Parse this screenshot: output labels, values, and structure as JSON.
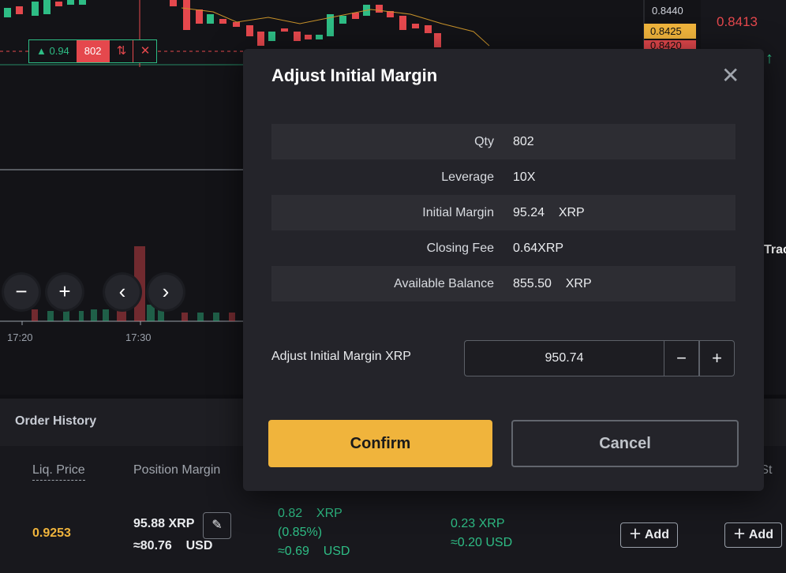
{
  "chart": {
    "price_axis": {
      "top": "0.8440",
      "last": "0.8425",
      "partial": "0.8420"
    },
    "side_price": "0.8413",
    "side_label": "Trac",
    "position_tag": {
      "pnl": "▲ 0.94",
      "qty": "802"
    },
    "controls": {
      "zoom_out": "−",
      "zoom_in": "+",
      "prev": "‹",
      "next": "›"
    },
    "time_labels": [
      "17:20",
      "17:30"
    ],
    "colors": {
      "up": "#2ebd85",
      "down": "#e5484d",
      "accent": "#f0b43c"
    }
  },
  "bottom": {
    "order_history": "Order History",
    "columns": {
      "liq_price": "Liq. Price",
      "position_margin": "Position Margin",
      "truncated": "g St"
    },
    "row": {
      "liq_price": "0.9253",
      "margin_xrp": "95.88 XRP",
      "margin_usd": "≈80.76    USD",
      "pnl_xrp": "0.82    XRP",
      "pnl_pct": "(0.85%)",
      "pnl_usd": "≈0.69    USD",
      "fee_xrp": "0.23 XRP",
      "fee_usd": "≈0.20 USD",
      "add_label": "Add"
    }
  },
  "modal": {
    "title": "Adjust Initial Margin",
    "rows": [
      {
        "label": "Qty",
        "value": "802"
      },
      {
        "label": "Leverage",
        "value": "10X"
      },
      {
        "label": "Initial Margin",
        "value": "95.24    XRP"
      },
      {
        "label": "Closing Fee",
        "value": "0.64XRP"
      },
      {
        "label": "Available Balance",
        "value": "855.50    XRP"
      }
    ],
    "adjust_label": "Adjust Initial Margin XRP",
    "adjust_value": "950.74",
    "minus": "−",
    "plus": "+",
    "confirm": "Confirm",
    "cancel": "Cancel"
  }
}
